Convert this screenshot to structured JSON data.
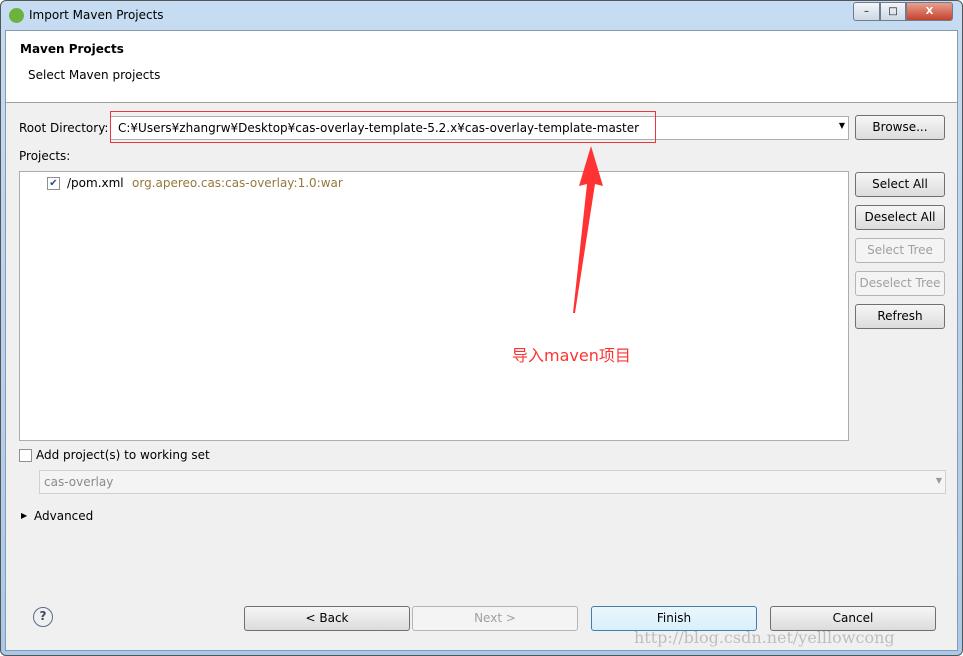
{
  "window": {
    "title": "Import Maven Projects",
    "minimize": "–",
    "maximize": "□",
    "close": "X"
  },
  "header": {
    "title": "Maven Projects",
    "subtitle": "Select Maven projects"
  },
  "root": {
    "label": "Root Directory:",
    "value": "C:¥Users¥zhangrw¥Desktop¥cas-overlay-template-5.2.x¥cas-overlay-template-master",
    "browse": "Browse..."
  },
  "projects": {
    "label": "Projects:",
    "items": [
      {
        "name": "/pom.xml",
        "coords": "org.apereo.cas:cas-overlay:1.0:war",
        "checked": true
      }
    ]
  },
  "side_buttons": {
    "select_all": "Select All",
    "deselect_all": "Deselect All",
    "select_tree": "Select Tree",
    "deselect_tree": "Deselect Tree",
    "refresh": "Refresh"
  },
  "working_set": {
    "label": "Add project(s) to working set",
    "checked": false,
    "value": "cas-overlay"
  },
  "advanced": "Advanced",
  "annotation": {
    "text": "导入maven项目",
    "color": "#ff3333"
  },
  "footer": {
    "back": "< Back",
    "next": "Next >",
    "finish": "Finish",
    "cancel": "Cancel",
    "help": "?"
  },
  "watermark": "http://blog.csdn.net/yelllowcong"
}
